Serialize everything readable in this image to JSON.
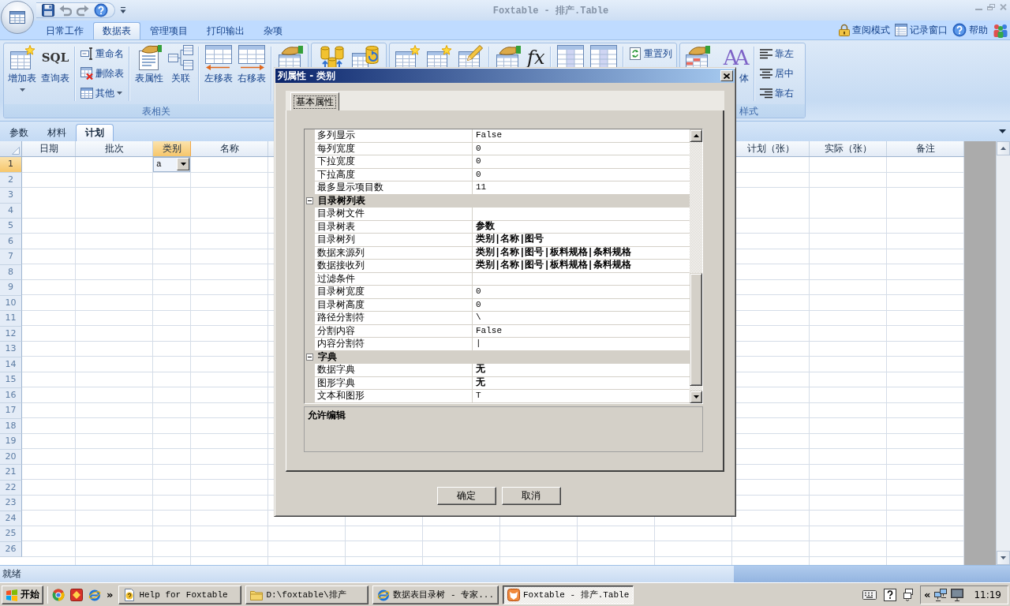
{
  "window": {
    "title": "Foxtable - 排产.Table"
  },
  "ribbon": {
    "tabs": [
      {
        "label": "日常工作",
        "selected": false
      },
      {
        "label": "数据表",
        "selected": true
      },
      {
        "label": "管理项目",
        "selected": false
      },
      {
        "label": "打印输出",
        "selected": false
      },
      {
        "label": "杂项",
        "selected": false
      }
    ],
    "links": [
      {
        "label": "查阅模式"
      },
      {
        "label": "记录窗口"
      },
      {
        "label": "帮助"
      }
    ],
    "groups": [
      {
        "label": "表相关",
        "items": [
          {
            "kind": "large",
            "label": "增加表",
            "dropdown": true
          },
          {
            "kind": "large",
            "label": "查询表",
            "icon_text": "SQL",
            "dropdown": false
          },
          {
            "kind": "separator"
          },
          {
            "kind": "stack",
            "buttons": [
              {
                "label": "重命名",
                "dropdown": false
              },
              {
                "label": "删除表",
                "dropdown": false
              },
              {
                "label": "其他",
                "dropdown": true
              }
            ]
          },
          {
            "kind": "separator"
          },
          {
            "kind": "large",
            "label": "表属性",
            "dropdown": false
          },
          {
            "kind": "large",
            "label": "关联",
            "dropdown": false
          },
          {
            "kind": "separator"
          },
          {
            "kind": "large",
            "label": "左移表",
            "dropdown": false
          },
          {
            "kind": "large",
            "label": "右移表",
            "dropdown": false
          },
          {
            "kind": "separator"
          },
          {
            "kind": "large"
          }
        ]
      },
      {
        "items": [
          {
            "kind": "large"
          },
          {
            "kind": "large"
          }
        ]
      },
      {
        "items": [
          {
            "kind": "large"
          },
          {
            "kind": "large"
          },
          {
            "kind": "large"
          },
          {
            "kind": "separator"
          },
          {
            "kind": "large"
          },
          {
            "kind": "large",
            "icon_text": "fx"
          },
          {
            "kind": "separator"
          },
          {
            "kind": "large"
          },
          {
            "kind": "large"
          },
          {
            "kind": "separator"
          },
          {
            "kind": "stack",
            "buttons": [
              {
                "label": "重置列",
                "dropdown": false
              }
            ]
          }
        ]
      },
      {
        "label": "样式",
        "items": [
          {
            "kind": "large"
          },
          {
            "kind": "large",
            "label": "体",
            "icon_text": "AA",
            "dropdown": false
          },
          {
            "kind": "separator"
          },
          {
            "kind": "stack",
            "buttons": [
              {
                "label": "靠左",
                "dropdown": false
              },
              {
                "label": "居中",
                "dropdown": false
              },
              {
                "label": "靠右",
                "dropdown": false
              }
            ]
          }
        ]
      }
    ]
  },
  "sheet_tabs": [
    {
      "label": "参数",
      "selected": false
    },
    {
      "label": "材料",
      "selected": false
    },
    {
      "label": "计划",
      "selected": true
    }
  ],
  "grid": {
    "columns": [
      {
        "label": "日期",
        "selected": false
      },
      {
        "label": "批次",
        "selected": false
      },
      {
        "label": "类别",
        "selected": true
      },
      {
        "label": "名称",
        "selected": false
      },
      {
        "label": "计划（张）",
        "selected": false
      },
      {
        "label": "实际（张）",
        "selected": false
      },
      {
        "label": "备注",
        "selected": false
      }
    ],
    "rows": [
      {
        "number": "1",
        "selected": true,
        "editor": {
          "value": "a"
        }
      },
      {
        "number": "2",
        "selected": false
      },
      {
        "number": "3",
        "selected": false
      },
      {
        "number": "4",
        "selected": false
      },
      {
        "number": "5",
        "selected": false
      },
      {
        "number": "6",
        "selected": false
      },
      {
        "number": "7",
        "selected": false
      },
      {
        "number": "8",
        "selected": false
      },
      {
        "number": "9",
        "selected": false
      },
      {
        "number": "10",
        "selected": false
      },
      {
        "number": "11",
        "selected": false
      },
      {
        "number": "12",
        "selected": false
      },
      {
        "number": "13",
        "selected": false
      },
      {
        "number": "14",
        "selected": false
      },
      {
        "number": "15",
        "selected": false
      },
      {
        "number": "16",
        "selected": false
      },
      {
        "number": "17",
        "selected": false
      },
      {
        "number": "18",
        "selected": false
      },
      {
        "number": "19",
        "selected": false
      },
      {
        "number": "20",
        "selected": false
      },
      {
        "number": "21",
        "selected": false
      },
      {
        "number": "22",
        "selected": false
      },
      {
        "number": "23",
        "selected": false
      },
      {
        "number": "24",
        "selected": false
      },
      {
        "number": "25",
        "selected": false
      },
      {
        "number": "26",
        "selected": false
      }
    ]
  },
  "status_bar": {
    "text": "就绪"
  },
  "dialog": {
    "title": "列属性 - 类别",
    "tabs": [
      {
        "label": "基本属性",
        "selected": true
      }
    ],
    "properties": [
      {
        "kind": "property",
        "name": "多列显示",
        "value": "False",
        "modified": false
      },
      {
        "kind": "property",
        "name": "每列宽度",
        "value": "0",
        "modified": false
      },
      {
        "kind": "property",
        "name": "下拉宽度",
        "value": "0",
        "modified": false
      },
      {
        "kind": "property",
        "name": "下拉高度",
        "value": "0",
        "modified": false
      },
      {
        "kind": "property",
        "name": "最多显示项目数",
        "value": "11",
        "modified": false
      },
      {
        "kind": "category",
        "name": "目录树列表",
        "expanded": true
      },
      {
        "kind": "property",
        "name": "目录树文件"
      },
      {
        "kind": "property",
        "name": "目录树表",
        "value": "参数",
        "modified": true
      },
      {
        "kind": "property",
        "name": "目录树列",
        "value": "类别|名称|图号",
        "modified": true
      },
      {
        "kind": "property",
        "name": "数据来源列",
        "value": "类别|名称|图号|板料规格|条料规格",
        "modified": true
      },
      {
        "kind": "property",
        "name": "数据接收列",
        "value": "类别|名称|图号|板料规格|条料规格",
        "modified": true
      },
      {
        "kind": "property",
        "name": "过滤条件"
      },
      {
        "kind": "property",
        "name": "目录树宽度",
        "value": "0",
        "modified": false
      },
      {
        "kind": "property",
        "name": "目录树高度",
        "value": "0",
        "modified": false
      },
      {
        "kind": "property",
        "name": "路径分割符",
        "value": "\\",
        "modified": false
      },
      {
        "kind": "property",
        "name": "分割内容",
        "value": "False",
        "modified": false
      },
      {
        "kind": "property",
        "name": "内容分割符",
        "value": "|",
        "modified": false
      },
      {
        "kind": "category",
        "name": "字典",
        "expanded": true
      },
      {
        "kind": "property",
        "name": "数据字典",
        "value": "无",
        "modified": true
      },
      {
        "kind": "property",
        "name": "图形字典",
        "value": "无",
        "modified": true
      },
      {
        "kind": "property",
        "name": "文本和图形",
        "value": "T",
        "modified": false
      }
    ],
    "description": "允许编辑",
    "buttons": [
      {
        "label": "确定"
      },
      {
        "label": "取消"
      }
    ]
  },
  "taskbar": {
    "start": "开始",
    "quick_launch_more": "»",
    "tasks": [
      {
        "label": "Help for Foxtable",
        "selected": false
      },
      {
        "label": "D:\\foxtable\\排产",
        "selected": false
      },
      {
        "label": "数据表目录树 - 专家...",
        "selected": false
      },
      {
        "label": "Foxtable - 排产.Table",
        "selected": true
      }
    ],
    "tray_expand": "«",
    "clock": "11:19"
  }
}
